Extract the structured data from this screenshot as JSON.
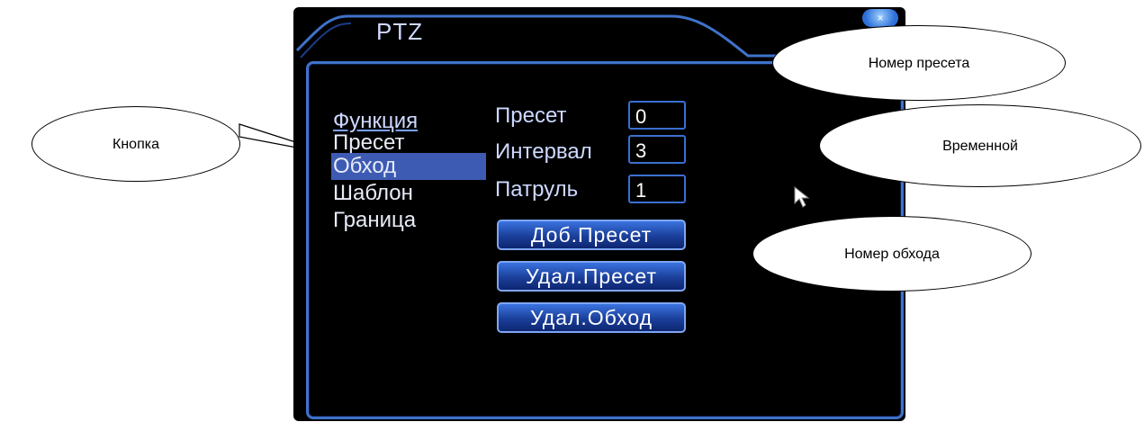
{
  "window": {
    "title": "PTZ"
  },
  "menu": {
    "title": "Функция",
    "items": [
      {
        "label": "Пресет"
      },
      {
        "label": "Обход",
        "selected": true
      },
      {
        "label": "Шаблон"
      },
      {
        "label": "Граница"
      }
    ]
  },
  "fields": {
    "preset": {
      "label": "Пресет",
      "value": "0"
    },
    "interval": {
      "label": "Интервал",
      "value": "3"
    },
    "patrol": {
      "label": "Патруль",
      "value": "1"
    }
  },
  "buttons": {
    "add_preset": "Доб.Пресет",
    "delete_preset": "Удал.Пресет",
    "delete_tour": "Удал.Обход"
  },
  "callouts": {
    "button": "Кнопка",
    "preset_number": "Номер пресета",
    "interval": "Временной",
    "tour_number": "Номер обхода"
  },
  "colors": {
    "screen_bg": "#000000",
    "frame": "#3f72c9",
    "selection": "#3d5bb3",
    "button_top": "#3a73e0",
    "button_bottom": "#0d2570"
  }
}
